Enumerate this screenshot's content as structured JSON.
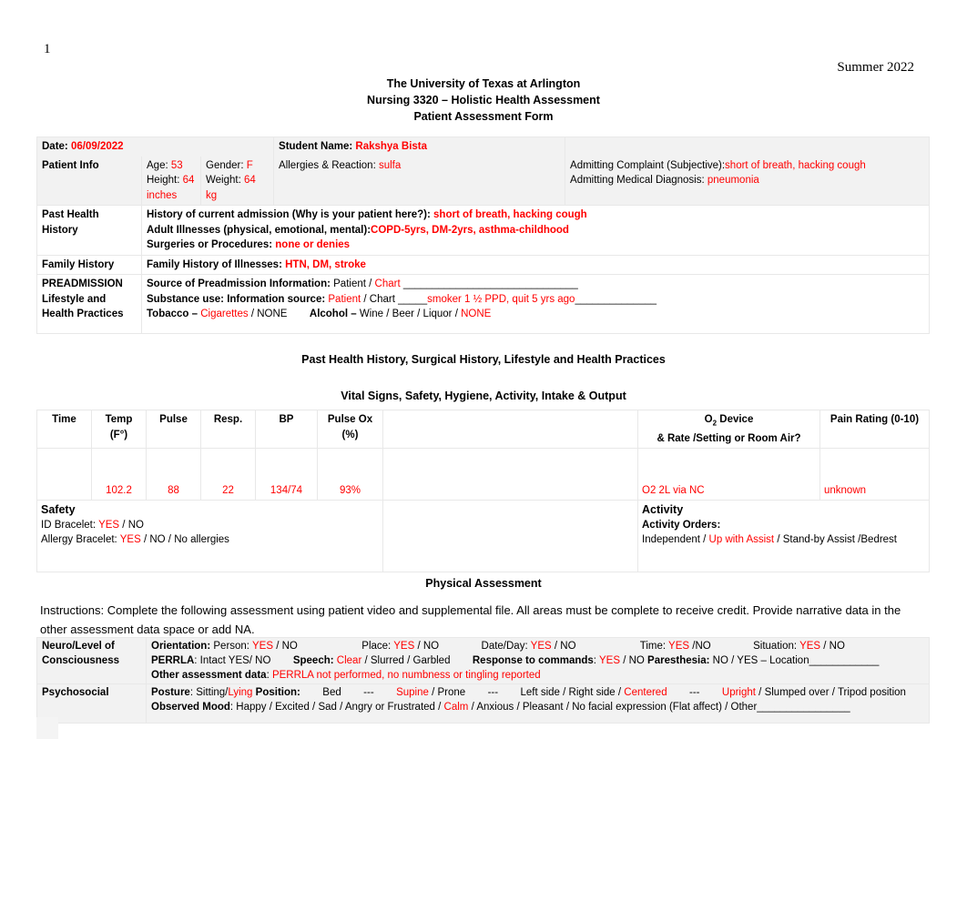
{
  "document": {
    "page_number": "1",
    "term": "Summer 2022",
    "title_lines": [
      "The University of Texas at Arlington",
      "Nursing 3320 – Holistic Health Assessment",
      "Patient Assessment Form"
    ]
  },
  "patient_info": {
    "date_label": "Date:",
    "date_value": "06/09/2022",
    "student_name_label": "Student Name:",
    "student_name_value": "Rakshya Bista",
    "row_label": "Patient Info",
    "age_label": "Age:",
    "age_value": "53",
    "gender_label": "Gender:",
    "gender_value": "F",
    "height_label": "Height:",
    "height_value": "64 inches",
    "weight_label": "Weight:",
    "weight_value": "64 kg",
    "allergies_label": "Allergies & Reaction:",
    "allergies_value": "sulfa",
    "admitting_complaint_label": "Admitting Complaint (Subjective):",
    "admitting_complaint_value": "short of breath, hacking cough",
    "admitting_diagnosis_label": "Admitting Medical Diagnosis:",
    "admitting_diagnosis_value": "pneumonia"
  },
  "past_health_history": {
    "row_label": "Past Health History",
    "current_admission_label": "History of current admission (Why is your patient here?):",
    "current_admission_value": "short of breath, hacking cough",
    "adult_illnesses_label": "Adult Illnesses (physical, emotional, mental):",
    "adult_illnesses_value": "COPD-5yrs, DM-2yrs, asthma-childhood",
    "surgeries_label": "Surgeries or Procedures:",
    "surgeries_value": "none or denies"
  },
  "family_history": {
    "row_label": "Family History",
    "illnesses_label": "Family History of Illnesses:",
    "illnesses_value": "HTN, DM, stroke"
  },
  "preadmission": {
    "row_label": "PREADMISSION Lifestyle and Health Practices",
    "source_label": "Source of Preadmission Information:",
    "source_option_patient": "Patient",
    "source_option_chart": "Chart",
    "source_blank": "______________________________",
    "substance_label": "Substance use:  Information source:",
    "substance_option_patient": "Patient",
    "substance_option_chart": "Chart",
    "substance_blank_pre": "_____",
    "substance_value": "smoker 1 ½ PPD, quit 5 yrs ago",
    "substance_blank_post": "______________",
    "tobacco_label": "Tobacco –",
    "tobacco_option_cigarettes": "Cigarettes",
    "tobacco_option_none": "NONE",
    "alcohol_label": "Alcohol –",
    "alcohol_option_wine": "Wine",
    "alcohol_option_beer": "Beer",
    "alcohol_option_liquor": "Liquor",
    "alcohol_option_none": "NONE"
  },
  "captions": {
    "past_health": "Past Health History, Surgical History, Lifestyle and Health Practices",
    "vital_signs": "Vital Signs, Safety, Hygiene, Activity, Intake & Output",
    "physical_assessment": "Physical Assessment"
  },
  "vitals": {
    "headers": {
      "time": "Time",
      "temp": "Temp (F°)",
      "temp_line1": "Temp",
      "temp_line2": "(F°)",
      "pulse": "Pulse",
      "resp": "Resp.",
      "bp": "BP",
      "pulse_ox_line1": "Pulse Ox",
      "pulse_ox_line2": "(%)",
      "o2_device_line1": "O2 Device",
      "o2_device_line2": "& Rate /Setting or Room Air?",
      "pain_rating": "Pain Rating (0-10)"
    },
    "values": {
      "time": "",
      "temp": "102.2",
      "pulse": "88",
      "resp": "22",
      "bp": "134/74",
      "pulse_ox": "93%",
      "o2_device": "O2 2L via NC",
      "pain_rating": "unknown"
    }
  },
  "safety": {
    "heading": "Safety",
    "id_bracelet_label": "ID Bracelet:",
    "id_bracelet_yes": "YES",
    "id_bracelet_no": "NO",
    "allergy_bracelet_label": "Allergy Bracelet:",
    "allergy_bracelet_yes": "YES",
    "allergy_bracelet_no": "NO",
    "allergy_bracelet_none": "No allergies"
  },
  "activity": {
    "heading": "Activity",
    "orders_label": "Activity Orders:",
    "option_independent": "Independent",
    "option_up_with_assist": "Up with Assist",
    "option_standby_assist": "Stand-by Assist",
    "option_bedrest": "Bedrest"
  },
  "instructions": {
    "text": "Instructions: Complete the following assessment using patient video and supplemental file. All areas must be complete to receive credit. Provide narrative data in the other assessment data space or add NA."
  },
  "neuro": {
    "row_label": "Neuro/Level of Consciousness",
    "orientation_label": "Orientation:",
    "person_label": "Person:",
    "person_yes": "YES",
    "person_no": "NO",
    "place_label": "Place:",
    "place_yes": "YES",
    "place_no": "NO",
    "date_day_label": "Date/Day:",
    "date_day_yes": "YES",
    "date_day_no": "NO",
    "time_label": "Time:",
    "time_yes": "YES",
    "time_no": "NO",
    "situation_label": "Situation:",
    "situation_yes": "YES",
    "situation_no": "NO",
    "perrla_label": "PERRLA",
    "perrla_intact": ": Intact   YES/ NO",
    "speech_label_s": "S",
    "speech_label_rest": "peech:",
    "speech_clear": "Clear",
    "speech_slurred": "Slurred",
    "speech_garbled": "Garbled",
    "response_label": "Response to commands",
    "response_yes": "YES",
    "response_no": "NO",
    "paresthesia_label": "Paresthesia:",
    "paresthesia_no": "NO",
    "paresthesia_yes": "YES",
    "paresthesia_location": "– Location",
    "paresthesia_blank": "____________",
    "other_label": "Other assessment data",
    "other_value": "PERRLA not performed, no numbness or tingling reported"
  },
  "psychosocial": {
    "row_label": "Psychosocial",
    "posture_label": "Posture",
    "posture_sitting": "Sitting/",
    "posture_lying": "Lying",
    "position_label": "Position:",
    "position_bed": "Bed",
    "dash": "---",
    "position_supine": "Supine",
    "position_prone": "Prone",
    "position_left": "Left side",
    "position_right": "Right side",
    "position_centered": "Centered",
    "position_upright": "Upright",
    "position_slumped": "Slumped over",
    "position_tripod": "Tripod position",
    "mood_label": "Observed Mood",
    "mood_happy": "Happy",
    "mood_excited": "Excited",
    "mood_sad": "Sad",
    "mood_angry": "Angry or Frustrated",
    "mood_calm": "Calm",
    "mood_anxious": "Anxious",
    "mood_pleasant": "Pleasant",
    "mood_flat": "No facial expression (Flat affect)",
    "mood_other": "Other",
    "mood_other_blank": "________________"
  },
  "colors": {
    "entry_red": "#ff0000",
    "shade_gray": "#f2f2f2",
    "border_gray": "#e8e8e8"
  }
}
